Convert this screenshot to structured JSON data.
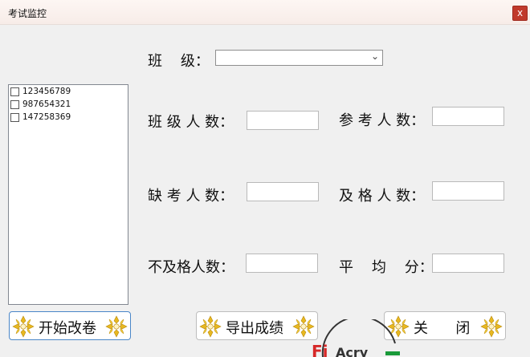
{
  "window": {
    "title": "考试监控",
    "close_label": "x"
  },
  "class_select": {
    "label": "班    级：",
    "value": ""
  },
  "stats": {
    "class_count_label": "班 级 人 数：",
    "taking_count_label": "参 考 人 数：",
    "absent_count_label": "缺 考 人 数：",
    "pass_count_label": "及 格 人 数：",
    "fail_count_label": "不及格人数：",
    "average_label": "平    均    分："
  },
  "student_list": [
    {
      "id": "123456789",
      "checked": false
    },
    {
      "id": "987654321",
      "checked": false
    },
    {
      "id": "147258369",
      "checked": false
    }
  ],
  "buttons": {
    "start_grading": "开始改卷",
    "export_scores": "导出成绩",
    "close": "关      闭"
  },
  "colors": {
    "close_button": "#c0392b",
    "ornament": "#e8b820",
    "focus_border": "#4a86c8",
    "logo_red": "#d62828",
    "logo_green": "#1a9a3a"
  }
}
